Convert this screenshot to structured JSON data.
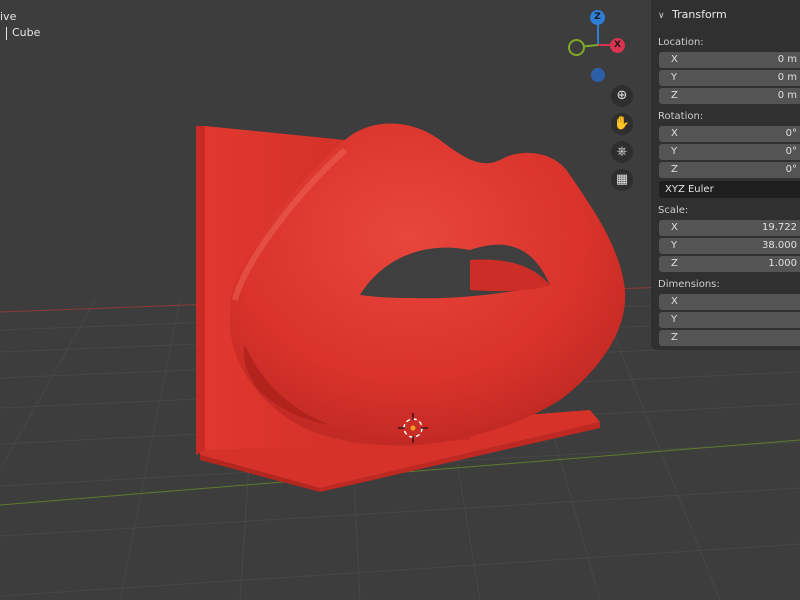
{
  "viewport": {
    "mode_label": "ive",
    "object_label": "Cube"
  },
  "gizmo": {
    "z_axis": "Z",
    "x_axis": "X",
    "colors": {
      "x": "#d8344f",
      "y": "#7fa826",
      "z": "#2d7fd6"
    }
  },
  "nav_buttons": [
    "zoom-icon",
    "hand-icon",
    "camera-icon",
    "grid-icon"
  ],
  "panel": {
    "title": "Transform",
    "location": {
      "label": "Location:",
      "x_label": "X",
      "x": "0 m",
      "y_label": "Y",
      "y": "0 m",
      "z_label": "Z",
      "z": "0 m"
    },
    "rotation": {
      "label": "Rotation:",
      "x_label": "X",
      "x": "0°",
      "y_label": "Y",
      "y": "0°",
      "z_label": "Z",
      "z": "0°"
    },
    "rotation_mode": "XYZ Euler",
    "scale": {
      "label": "Scale:",
      "x_label": "X",
      "x": "19.722",
      "y_label": "Y",
      "y": "38.000",
      "z_label": "Z",
      "z": "1.000"
    },
    "dimensions": {
      "label": "Dimensions:",
      "x_label": "X",
      "y_label": "Y",
      "z_label": "Z"
    }
  },
  "colors": {
    "background": "#3d3d3d",
    "object_red": "#d9332b",
    "panel": "#303030",
    "field": "#545454"
  }
}
